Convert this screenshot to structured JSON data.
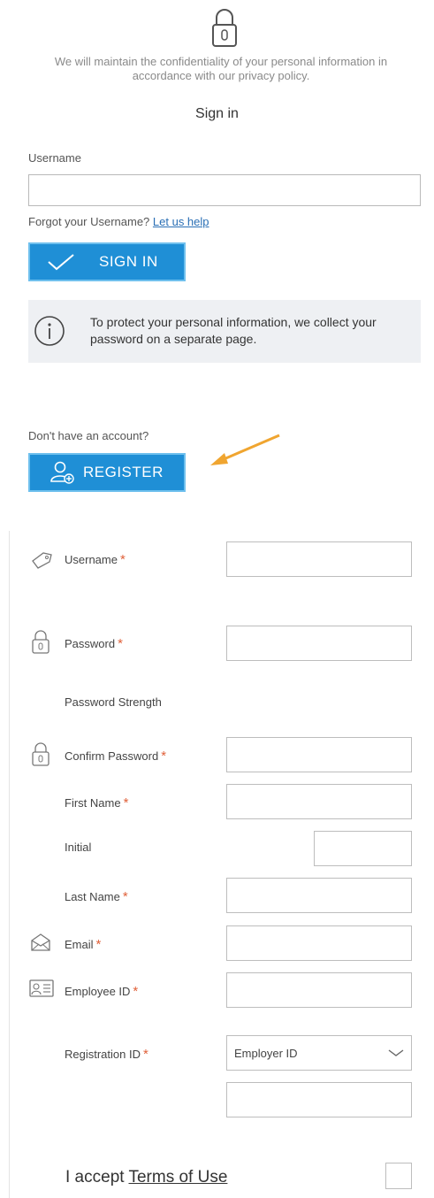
{
  "privacy_text": "We will maintain the confidentiality of your personal information in accordance with our privacy policy.",
  "signin_title": "Sign in",
  "username_label": "Username",
  "username_value": "",
  "forgot_text": "Forgot your Username?",
  "forgot_link": "Let us help",
  "signin_button": "SIGN IN",
  "info_text": "To protect your personal information, we collect your password on a separate page.",
  "no_account_text": "Don't have an account?",
  "register_button": "REGISTER",
  "colors": {
    "accent": "#1f8fd6",
    "arrow": "#f0a530",
    "required": "#e0613a"
  },
  "registration": {
    "fields": {
      "username": "Username",
      "password": "Password",
      "password_strength": "Password Strength",
      "confirm_password": "Confirm Password",
      "first_name": "First Name",
      "initial": "Initial",
      "last_name": "Last Name",
      "email": "Email",
      "employee_id": "Employee ID",
      "registration_id": "Registration ID"
    },
    "required_mark": "*",
    "registration_select_value": "Employer ID",
    "terms_prefix": "I accept ",
    "terms_link": "Terms of Use"
  }
}
